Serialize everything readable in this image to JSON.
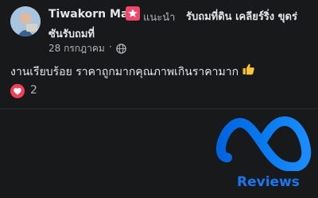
{
  "post": {
    "author": "Tiwakorn Max",
    "recommends": "แนะนำ",
    "page_name_line1": "รับถมที่ดิน เคลียร์ริ่ง ขุดร่",
    "page_name_line2": "ซันรับถมที่",
    "date": "28 กรกฎาคม",
    "separator": "·",
    "text": "งานเรียบร้อย ราคาถูกมากคุณภาพเกินราคามาก",
    "reaction_count": "2"
  },
  "icons": {
    "recommend": "recommend-badge-icon",
    "privacy": "globe-icon",
    "emoji": "thumbs-up-emoji-icon",
    "reaction": "love-reaction-icon"
  },
  "branding": {
    "label": "Reviews"
  },
  "colors": {
    "background": "#18191a",
    "recommend_badge": "#f0476a",
    "reaction_heart": "#f33e58",
    "meta_blue": "#1877f2"
  }
}
